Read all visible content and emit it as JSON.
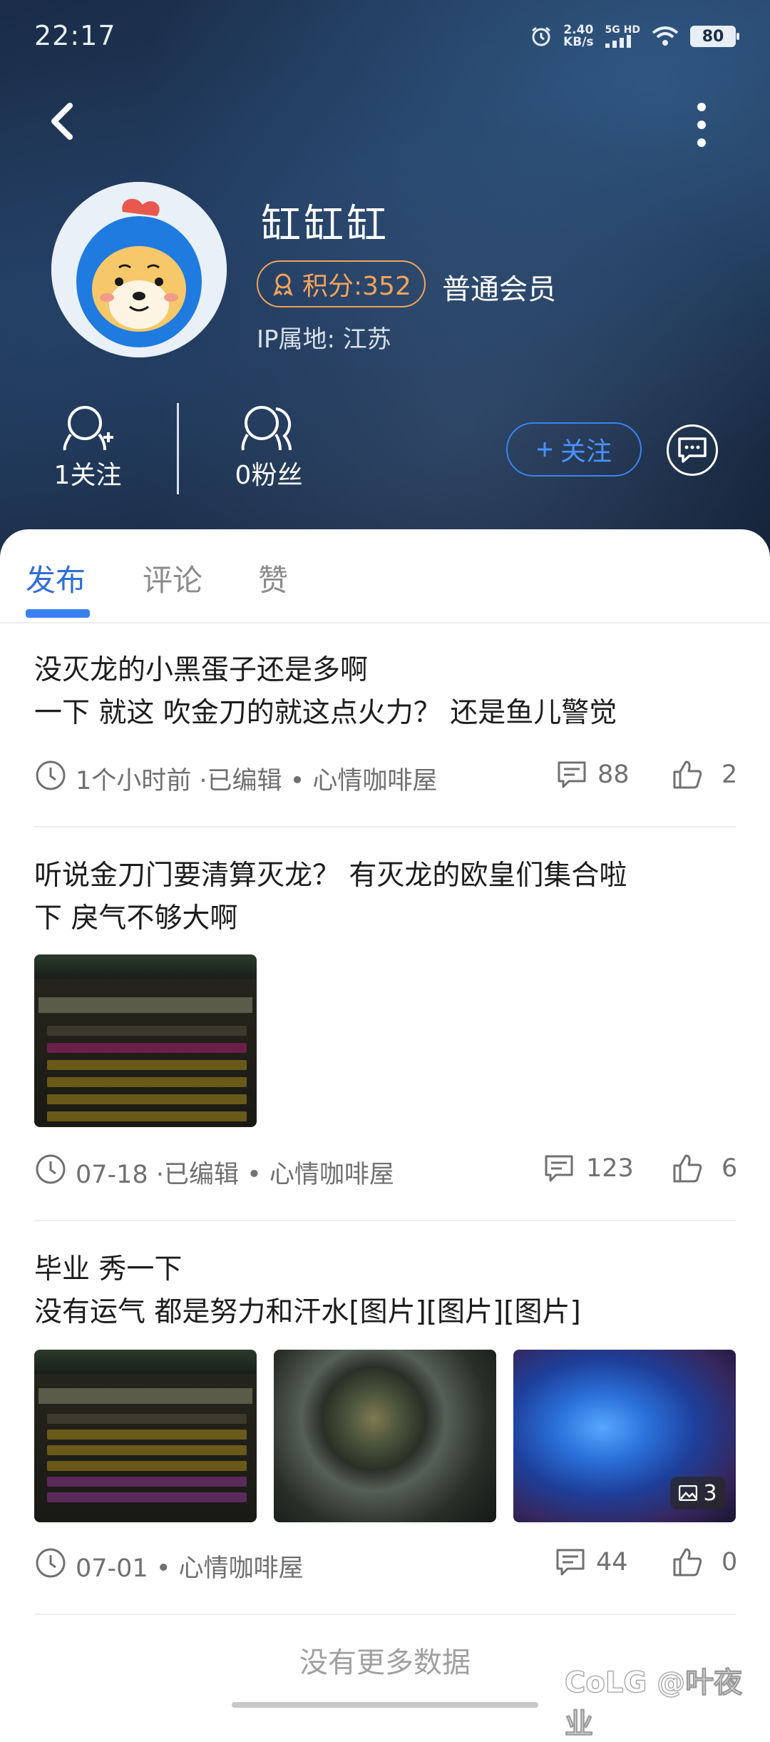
{
  "status_bar": {
    "time": "22:17",
    "net_speed_value": "2.40",
    "net_speed_unit": "KB/s",
    "network_label": "5G HD",
    "battery": "80"
  },
  "profile": {
    "name": "缸缸缸",
    "points": "积分:352",
    "member_level": "普通会员",
    "ip_location": "IP属地: 江苏",
    "following": "1关注",
    "followers": "0粉丝",
    "follow_button": "关注"
  },
  "tabs": [
    {
      "label": "发布",
      "active": true
    },
    {
      "label": "评论",
      "active": false
    },
    {
      "label": "赞",
      "active": false
    }
  ],
  "posts": [
    {
      "title": "没灭龙的小黑蛋子还是多啊",
      "body": "一下   就这  吹金刀的就这点火力？  还是鱼儿警觉",
      "meta": "1个小时前  ·已编辑   •   心情咖啡屋",
      "comments": "88",
      "likes": "2"
    },
    {
      "title": "听说金刀门要清算灭龙？    有灭龙的欧皇们集合啦",
      "body": "下   戾气不够大啊",
      "meta": "07-18  ·已编辑   •   心情咖啡屋",
      "comments": "123",
      "likes": "6"
    },
    {
      "title": "毕业   秀一下",
      "body": "没有运气 都是努力和汗水[图片][图片][图片]",
      "meta": "07-01   •   心情咖啡屋",
      "comments": "44",
      "likes": "0",
      "image_count": "3"
    }
  ],
  "footer": {
    "no_more": "没有更多数据",
    "watermark": "CoLG @叶夜业"
  },
  "colors": {
    "accent": "#3a7ff0",
    "points_orange": "#f5a35c",
    "hero_bg": "#1b2d48"
  }
}
